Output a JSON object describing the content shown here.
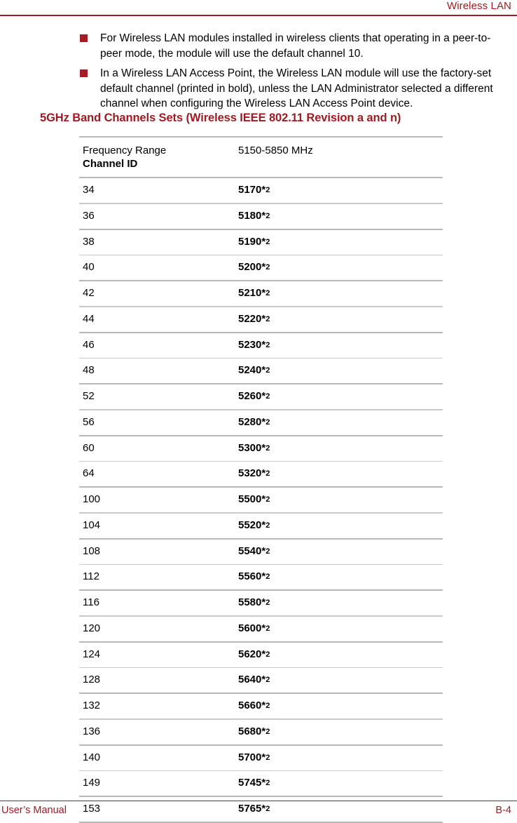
{
  "header": {
    "title": "Wireless LAN"
  },
  "notes": [
    {
      "marker": "square-bullet",
      "text": "For Wireless LAN modules installed in wireless clients that operating in a peer-to-peer mode, the module will use the default channel 10."
    },
    {
      "marker": "square-bullet",
      "text": "In a Wireless LAN Access Point, the Wireless LAN module will use the factory-set default channel (printed in bold), unless the LAN Administrator selected a different channel when configuring the Wireless LAN Access Point device."
    }
  ],
  "section": {
    "heading": "5GHz Band Channels Sets (Wireless IEEE 802.11 Revision a and n)"
  },
  "table": {
    "header": {
      "col1_line1": "Frequency Range",
      "col1_line2": "Channel ID",
      "col2": "5150-5850 MHz"
    },
    "footnote_mark": "*",
    "footnote_index": "2",
    "rows": [
      {
        "channel": "34",
        "frequency": "5170"
      },
      {
        "channel": "36",
        "frequency": "5180"
      },
      {
        "channel": "38",
        "frequency": "5190"
      },
      {
        "channel": "40",
        "frequency": "5200"
      },
      {
        "channel": "42",
        "frequency": "5210"
      },
      {
        "channel": "44",
        "frequency": "5220"
      },
      {
        "channel": "46",
        "frequency": "5230"
      },
      {
        "channel": "48",
        "frequency": "5240"
      },
      {
        "channel": "52",
        "frequency": "5260"
      },
      {
        "channel": "56",
        "frequency": "5280"
      },
      {
        "channel": "60",
        "frequency": "5300"
      },
      {
        "channel": "64",
        "frequency": "5320"
      },
      {
        "channel": "100",
        "frequency": "5500"
      },
      {
        "channel": "104",
        "frequency": "5520"
      },
      {
        "channel": "108",
        "frequency": "5540"
      },
      {
        "channel": "112",
        "frequency": "5560"
      },
      {
        "channel": "116",
        "frequency": "5580"
      },
      {
        "channel": "120",
        "frequency": "5600"
      },
      {
        "channel": "124",
        "frequency": "5620"
      },
      {
        "channel": "128",
        "frequency": "5640"
      },
      {
        "channel": "132",
        "frequency": "5660"
      },
      {
        "channel": "136",
        "frequency": "5680"
      },
      {
        "channel": "140",
        "frequency": "5700"
      },
      {
        "channel": "149",
        "frequency": "5745"
      },
      {
        "channel": "153",
        "frequency": "5765"
      }
    ]
  },
  "footer": {
    "left": "User’s Manual",
    "right": "B-4"
  },
  "colors": {
    "accent_red": "#9E1B22",
    "bullet_red": "#A51C24",
    "rule_gray": "#b7b7b7",
    "text_black": "#000000"
  }
}
